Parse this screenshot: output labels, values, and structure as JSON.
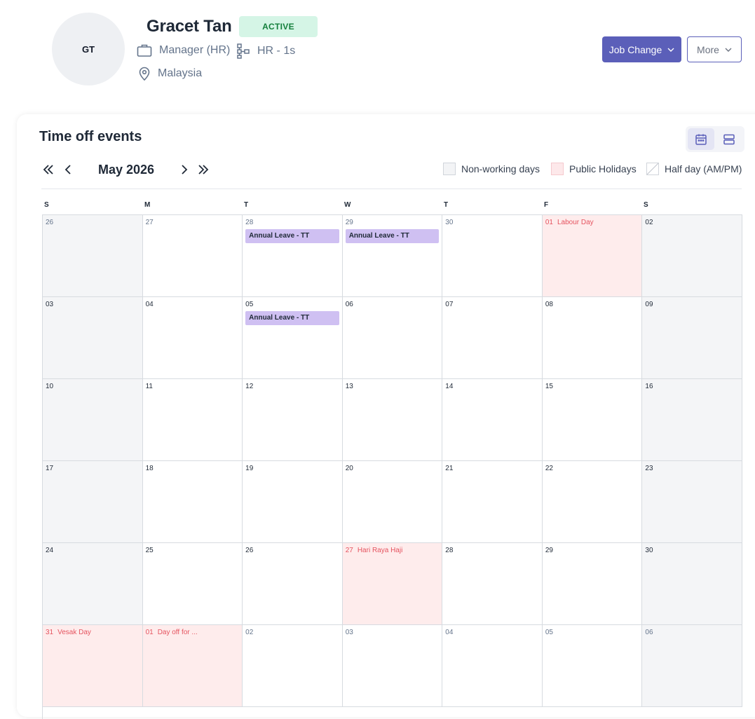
{
  "profile": {
    "initials": "GT",
    "name": "Gracet Tan",
    "status": "ACTIVE",
    "role": "Manager (HR)",
    "department": "HR - 1s",
    "location": "Malaysia"
  },
  "actions": {
    "job_change": "Job Change",
    "more": "More"
  },
  "calendar": {
    "title": "Time off events",
    "month": "May 2026",
    "legend": {
      "non_working": "Non-working days",
      "public_holidays": "Public Holidays",
      "half_day": "Half day (AM/PM)"
    },
    "weekdays": [
      "S",
      "M",
      "T",
      "W",
      "T",
      "F",
      "S"
    ],
    "weeks": [
      [
        {
          "day": "26",
          "out": true
        },
        {
          "day": "27",
          "out": true
        },
        {
          "day": "28",
          "out": true,
          "event": "Annual Leave - TT"
        },
        {
          "day": "29",
          "out": true,
          "event": "Annual Leave - TT"
        },
        {
          "day": "30",
          "out": true
        },
        {
          "day": "01",
          "holiday": "Labour Day"
        },
        {
          "day": "02"
        }
      ],
      [
        {
          "day": "03"
        },
        {
          "day": "04"
        },
        {
          "day": "05",
          "event": "Annual Leave - TT"
        },
        {
          "day": "06"
        },
        {
          "day": "07"
        },
        {
          "day": "08"
        },
        {
          "day": "09"
        }
      ],
      [
        {
          "day": "10"
        },
        {
          "day": "11"
        },
        {
          "day": "12"
        },
        {
          "day": "13"
        },
        {
          "day": "14"
        },
        {
          "day": "15"
        },
        {
          "day": "16"
        }
      ],
      [
        {
          "day": "17"
        },
        {
          "day": "18"
        },
        {
          "day": "19"
        },
        {
          "day": "20"
        },
        {
          "day": "21"
        },
        {
          "day": "22"
        },
        {
          "day": "23"
        }
      ],
      [
        {
          "day": "24"
        },
        {
          "day": "25"
        },
        {
          "day": "26"
        },
        {
          "day": "27",
          "holiday": "Hari Raya Haji"
        },
        {
          "day": "28"
        },
        {
          "day": "29"
        },
        {
          "day": "30"
        }
      ],
      [
        {
          "day": "31",
          "holiday": "Vesak Day"
        },
        {
          "day": "01",
          "out": true,
          "holiday": "Day off for ..."
        },
        {
          "day": "02",
          "out": true
        },
        {
          "day": "03",
          "out": true
        },
        {
          "day": "04",
          "out": true
        },
        {
          "day": "05",
          "out": true
        },
        {
          "day": "06",
          "out": true
        }
      ]
    ]
  },
  "colors": {
    "primary": "#5b5fb9",
    "active_badge_bg": "#d5f5e6",
    "active_badge_text": "#15803d",
    "event_bg": "#cfc0f2",
    "holiday_bg": "#feecec",
    "holiday_text": "#e5535f",
    "weekend_bg": "#f4f5f7"
  },
  "icons": {
    "role": "briefcase-icon",
    "department": "org-chart-icon",
    "location": "map-pin-icon",
    "calendar_view": "calendar-icon",
    "list_view": "list-rows-icon"
  }
}
